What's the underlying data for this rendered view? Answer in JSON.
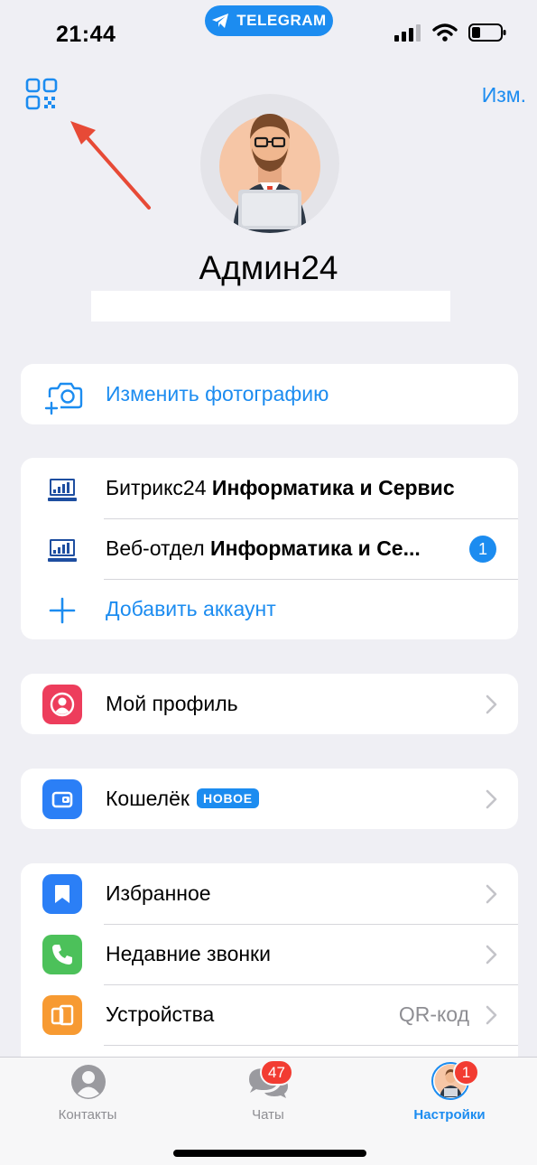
{
  "status": {
    "time": "21:44",
    "pill_label": "TELEGRAM"
  },
  "header": {
    "edit_label": "Изм.",
    "profile_name": "Админ24"
  },
  "photo": {
    "change_label": "Изменить фотографию"
  },
  "accounts": [
    {
      "prefix": "Битрикс24 ",
      "bold": "Информатика и Сервис",
      "badge": ""
    },
    {
      "prefix": "Веб-отдел ",
      "bold": "Информатика и Се...",
      "badge": "1"
    }
  ],
  "add_account_label": "Добавить аккаунт",
  "profile_item": {
    "label": "Мой профиль"
  },
  "wallet_item": {
    "label": "Кошелёк",
    "badge": "НОВОЕ"
  },
  "menu": [
    {
      "label": "Избранное",
      "value": ""
    },
    {
      "label": "Недавние звонки",
      "value": ""
    },
    {
      "label": "Устройства",
      "value": "QR-код"
    }
  ],
  "tabs": [
    {
      "label": "Контакты",
      "badge": ""
    },
    {
      "label": "Чаты",
      "badge": "47"
    },
    {
      "label": "Настройки",
      "badge": "1"
    }
  ],
  "colors": {
    "accent": "#1c8cf0",
    "background": "#efeff4",
    "profile_icon": "#ed3d5c",
    "wallet_icon": "#2b7ff6",
    "favorites_icon": "#2b7ff6",
    "calls_icon": "#4cc15a",
    "devices_icon": "#f79a32",
    "annotation_arrow": "#e74a36"
  },
  "icons": {
    "qr": "qr-code-icon",
    "camera": "camera-add-icon",
    "account": "computer-chart-icon",
    "plus": "plus-icon",
    "profile": "person-icon",
    "wallet": "wallet-icon",
    "favorites": "bookmark-icon",
    "calls": "phone-icon",
    "devices": "devices-icon",
    "chevron": "chevron-right-icon"
  }
}
